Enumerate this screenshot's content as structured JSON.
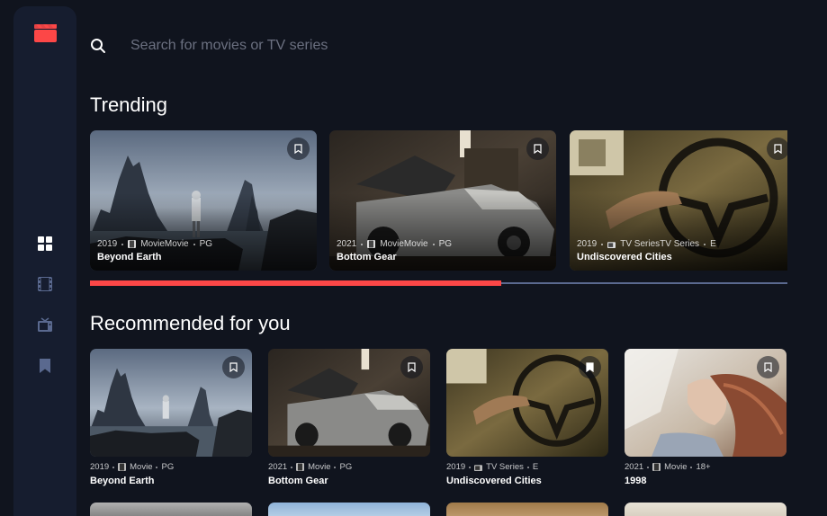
{
  "sidebar": {
    "logo_icon": "clapperboard-icon",
    "accent": "#fc4747",
    "items": [
      {
        "icon": "grid-icon",
        "active": true
      },
      {
        "icon": "film-icon",
        "active": false
      },
      {
        "icon": "tv-icon",
        "active": false
      },
      {
        "icon": "bookmark-icon",
        "active": false
      }
    ]
  },
  "search": {
    "placeholder": "Search for movies or TV series",
    "value": ""
  },
  "trending": {
    "title": "Trending",
    "scroll_progress": 0.59,
    "items": [
      {
        "year": "2019",
        "category": "MovieMovie",
        "rating": "PG",
        "title": "Beyond Earth",
        "category_icon": "film-icon"
      },
      {
        "year": "2021",
        "category": "MovieMovie",
        "rating": "PG",
        "title": "Bottom Gear",
        "category_icon": "film-icon"
      },
      {
        "year": "2019",
        "category": "TV SeriesTV Series",
        "rating": "E",
        "title": "Undiscovered Cities",
        "category_icon": "tv-icon"
      }
    ]
  },
  "recommended": {
    "title": "Recommended for you",
    "items": [
      {
        "year": "2019",
        "category": "Movie",
        "rating": "PG",
        "title": "Beyond Earth",
        "category_icon": "film-icon"
      },
      {
        "year": "2021",
        "category": "Movie",
        "rating": "PG",
        "title": "Bottom Gear",
        "category_icon": "film-icon"
      },
      {
        "year": "2019",
        "category": "TV Series",
        "rating": "E",
        "title": "Undiscovered Cities",
        "category_icon": "tv-icon"
      },
      {
        "year": "2021",
        "category": "Movie",
        "rating": "18+",
        "title": "1998",
        "category_icon": "film-icon"
      }
    ]
  }
}
